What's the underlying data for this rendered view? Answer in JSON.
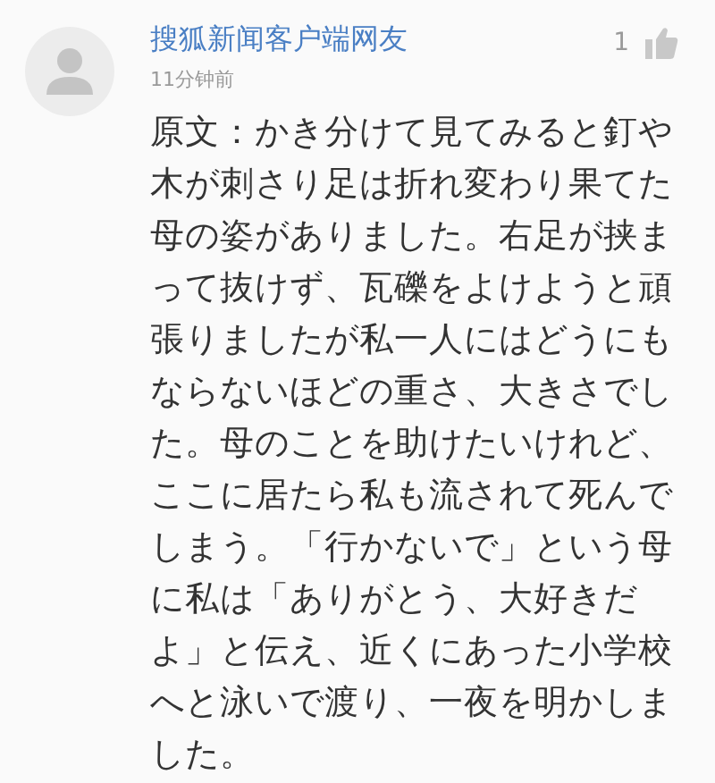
{
  "comment": {
    "author": "搜狐新闻客户端网友",
    "time": "11分钟前",
    "likes": "1",
    "text": "原文：かき分けて見てみると釘や木が刺さり足は折れ変わり果てた母の姿がありました。右足が挟まって抜けず、瓦礫をよけようと頑張りましたが私一人にはどうにもならないほどの重さ、大きさでした。母のことを助けたいけれど、ここに居たら私も流されて死んでしまう。「行かないで」という母に私は「ありがとう、大好きだよ」と伝え、近くにあった小学校へと泳いで渡り、一夜を明かしました。"
  }
}
